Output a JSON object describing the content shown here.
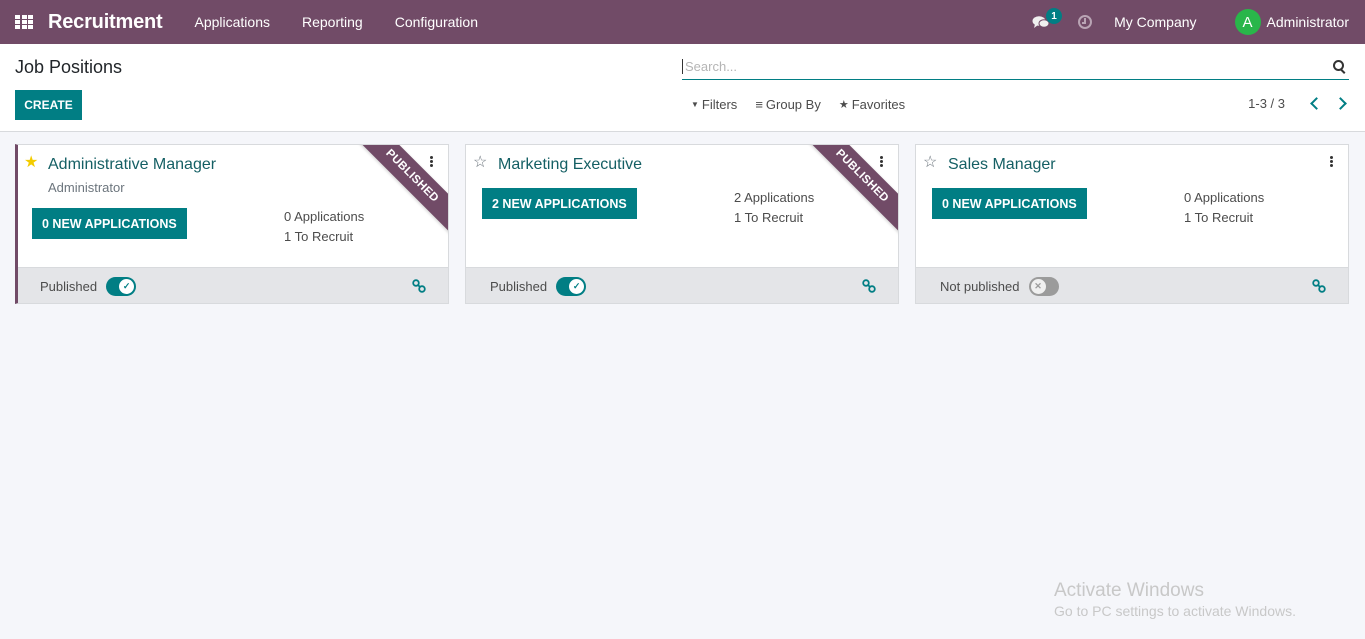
{
  "navbar": {
    "app_icon": "apps-grid-icon",
    "brand": "Recruitment",
    "menu": [
      {
        "label": "Applications"
      },
      {
        "label": "Reporting"
      },
      {
        "label": "Configuration"
      }
    ],
    "chat_icon": "chat-icon",
    "chat_count": "1",
    "activity_icon": "clock-icon",
    "company": "My Company",
    "user_initial": "A",
    "user_name": "Administrator",
    "colors": {
      "navbar": "#714b67",
      "avatar": "#29b64a",
      "badge": "#017e84"
    }
  },
  "control": {
    "title": "Job Positions",
    "create_label": "CREATE",
    "search_placeholder": "Search...",
    "search_value": "",
    "filters": [
      {
        "icon": "filter-icon",
        "label": "Filters"
      },
      {
        "icon": "list-icon",
        "label": "Group By"
      },
      {
        "icon": "star-icon",
        "label": "Favorites"
      }
    ],
    "pager": "1-3 / 3",
    "colors": {
      "primary": "#017e84"
    }
  },
  "jobs": [
    {
      "title": "Administrative Manager",
      "subtitle": "Administrator",
      "favorite": true,
      "new_applications_label": "0 NEW APPLICATIONS",
      "applications": "0 Applications",
      "to_recruit": "1 To Recruit",
      "ribbon": "PUBLISHED",
      "publish_label": "Published",
      "published": true
    },
    {
      "title": "Marketing Executive",
      "subtitle": "",
      "favorite": false,
      "new_applications_label": "2 NEW APPLICATIONS",
      "applications": "2 Applications",
      "to_recruit": "1 To Recruit",
      "ribbon": "PUBLISHED",
      "publish_label": "Published",
      "published": true
    },
    {
      "title": "Sales Manager",
      "subtitle": "",
      "favorite": false,
      "new_applications_label": "0 NEW APPLICATIONS",
      "applications": "0 Applications",
      "to_recruit": "1 To Recruit",
      "ribbon": "",
      "publish_label": "Not published",
      "published": false
    }
  ],
  "glyphs": {
    "star_filled": "★",
    "star_empty": "☆",
    "toggle_on": "✓",
    "toggle_off": "✕",
    "filter": "▼",
    "group": "≡",
    "favorite": "★"
  },
  "watermark": {
    "title": "Activate Windows",
    "subtitle": "Go to PC settings to activate Windows."
  }
}
